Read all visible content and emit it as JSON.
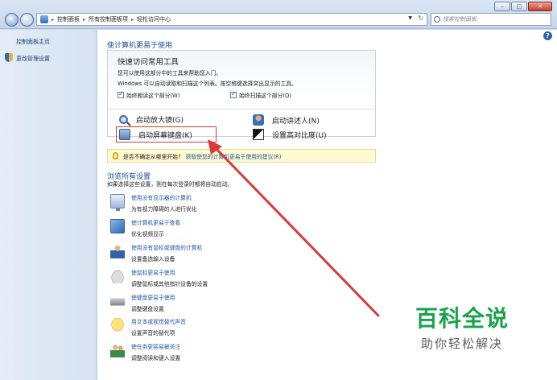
{
  "window": {
    "controls": [
      "–",
      "□",
      "✕"
    ]
  },
  "address_bar": {
    "segments": [
      "控制面板",
      "所有控制面板项",
      "轻松访问中心"
    ],
    "search_placeholder": "搜索控制面板"
  },
  "sidebar": {
    "items": [
      {
        "label": "控制面板主页"
      },
      {
        "label": "更改管理设置"
      }
    ]
  },
  "main": {
    "heading": "使计算机更易于使用",
    "quick_access": {
      "title": "快速访问常用工具",
      "line1": "您可以使用这部分中的工具来帮助您入门。",
      "line2": "Windows 可以自动读取和扫描这个列表。按空格键选择突出显示的工具。",
      "checkbox_read": "始终朗读这个部分(W)",
      "checkbox_scan": "始终扫描这个部分(O)",
      "tools": [
        {
          "label": "启动放大镜(G)"
        },
        {
          "label": "启动讲述人(N)"
        },
        {
          "label": "启动屏幕键盘(K)"
        },
        {
          "label": "设置高对比度(U)"
        }
      ]
    },
    "tip": {
      "prefix": "是否不确定从哪里开始?",
      "link": "获取使您的计算机更易于使用的建议(R)"
    },
    "browse": {
      "title": "浏览所有设置",
      "description": "如果选择这些设置，则在每次登录时都将自动启动。",
      "items": [
        {
          "link": "使用没有显示器的计算机",
          "desc": "为有视力障碍的人进行优化"
        },
        {
          "link": "使计算机更易于查看",
          "desc": "优化视频显示"
        },
        {
          "link": "使用没有鼠标或键盘的计算机",
          "desc": "设置备选输入设备"
        },
        {
          "link": "使鼠标更易于使用",
          "desc": "调整鼠标或其他指针设备的设置"
        },
        {
          "link": "使键盘更易于使用",
          "desc": "调整键盘设置"
        },
        {
          "link": "用文本或视觉替代声音",
          "desc": "设置声音的替代项"
        },
        {
          "link": "使任务更容易被关注",
          "desc": "调整阅读和键入设置"
        }
      ]
    }
  },
  "watermark": {
    "title": "百科全说",
    "subtitle": "助你轻松解决"
  },
  "colors": {
    "link": "#1f55a3",
    "heading": "#1f4f90",
    "annotation_red": "#d93a3a",
    "watermark_green": "#1aa34a"
  }
}
